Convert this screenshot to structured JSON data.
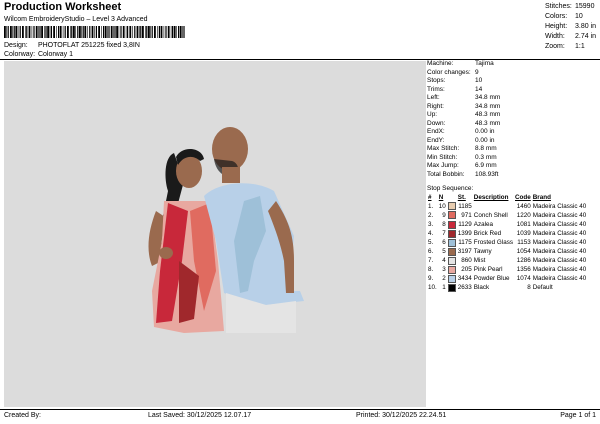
{
  "header": {
    "title": "Production Worksheet",
    "subtitle": "Wilcom EmbroideryStudio – Level 3 Advanced",
    "design_label": "Design:",
    "design_value": "PHOTOFLAT 251225 fixed 3,8IN",
    "colorway_label": "Colorway:",
    "colorway_value": "Colorway 1"
  },
  "stats": [
    {
      "k": "Stitches:",
      "v": "15990"
    },
    {
      "k": "Colors:",
      "v": "10"
    },
    {
      "k": "Height:",
      "v": "3.80 in"
    },
    {
      "k": "Width:",
      "v": "2.74 in"
    },
    {
      "k": "Zoom:",
      "v": "1:1"
    }
  ],
  "info": [
    {
      "k": "Machine:",
      "v": "Tajima"
    },
    {
      "k": "Color changes:",
      "v": "9"
    },
    {
      "k": "Stops:",
      "v": "10"
    },
    {
      "k": "Trims:",
      "v": "14"
    },
    {
      "k": "Left:",
      "v": "34.8 mm"
    },
    {
      "k": "Right:",
      "v": "34.8 mm"
    },
    {
      "k": "Up:",
      "v": "48.3 mm"
    },
    {
      "k": "Down:",
      "v": "48.3 mm"
    },
    {
      "k": "EndX:",
      "v": "0.00 in"
    },
    {
      "k": "EndY:",
      "v": "0.00 in"
    },
    {
      "k": "Max Stitch:",
      "v": "8.8 mm"
    },
    {
      "k": "Min Stitch:",
      "v": "0.3 mm"
    },
    {
      "k": "Max Jump:",
      "v": "6.9 mm"
    },
    {
      "k": "Total Bobbin:",
      "v": "108.93ft"
    }
  ],
  "sequence": {
    "title": "Stop Sequence:",
    "headers": [
      "#",
      "N",
      "St.",
      "Description",
      "Code",
      "Brand"
    ],
    "rows": [
      {
        "n": "1.",
        "needle": "10",
        "color": "#e8cdb0",
        "st": "1185",
        "desc": "",
        "code": "1460",
        "brand": "Madeira Classic 40"
      },
      {
        "n": "2.",
        "needle": "9",
        "color": "#e06b60",
        "st": "971",
        "desc": "Conch Shell",
        "code": "1220",
        "brand": "Madeira Classic 40"
      },
      {
        "n": "3.",
        "needle": "8",
        "color": "#c8283a",
        "st": "1129",
        "desc": "Azalea",
        "code": "1081",
        "brand": "Madeira Classic 40"
      },
      {
        "n": "4.",
        "needle": "7",
        "color": "#a0282c",
        "st": "1399",
        "desc": "Brick Red",
        "code": "1039",
        "brand": "Madeira Classic 40"
      },
      {
        "n": "5.",
        "needle": "6",
        "color": "#9ec0d8",
        "st": "1175",
        "desc": "Frosted Glass",
        "code": "1153",
        "brand": "Madeira Classic 40"
      },
      {
        "n": "6.",
        "needle": "5",
        "color": "#9a6a4e",
        "st": "3197",
        "desc": "Tawny",
        "code": "1054",
        "brand": "Madeira Classic 40"
      },
      {
        "n": "7.",
        "needle": "4",
        "color": "#e4e4e4",
        "st": "860",
        "desc": "Mist",
        "code": "1286",
        "brand": "Madeira Classic 40"
      },
      {
        "n": "8.",
        "needle": "3",
        "color": "#e8a8a0",
        "st": "205",
        "desc": "Pink Pearl",
        "code": "1356",
        "brand": "Madeira Classic 40"
      },
      {
        "n": "9.",
        "needle": "2",
        "color": "#b8d0e8",
        "st": "3434",
        "desc": "Powder Blue",
        "code": "1074",
        "brand": "Madeira Classic 40"
      },
      {
        "n": "10.",
        "needle": "1",
        "color": "#000000",
        "st": "2633",
        "desc": "Black",
        "code": "8",
        "brand": "Default"
      }
    ]
  },
  "footer": {
    "created": "Created By:",
    "saved": "Last Saved: 30/12/2025 12.07.17",
    "printed": "Printed: 30/12/2025 22.24.51",
    "page": "Page 1 of 1"
  }
}
